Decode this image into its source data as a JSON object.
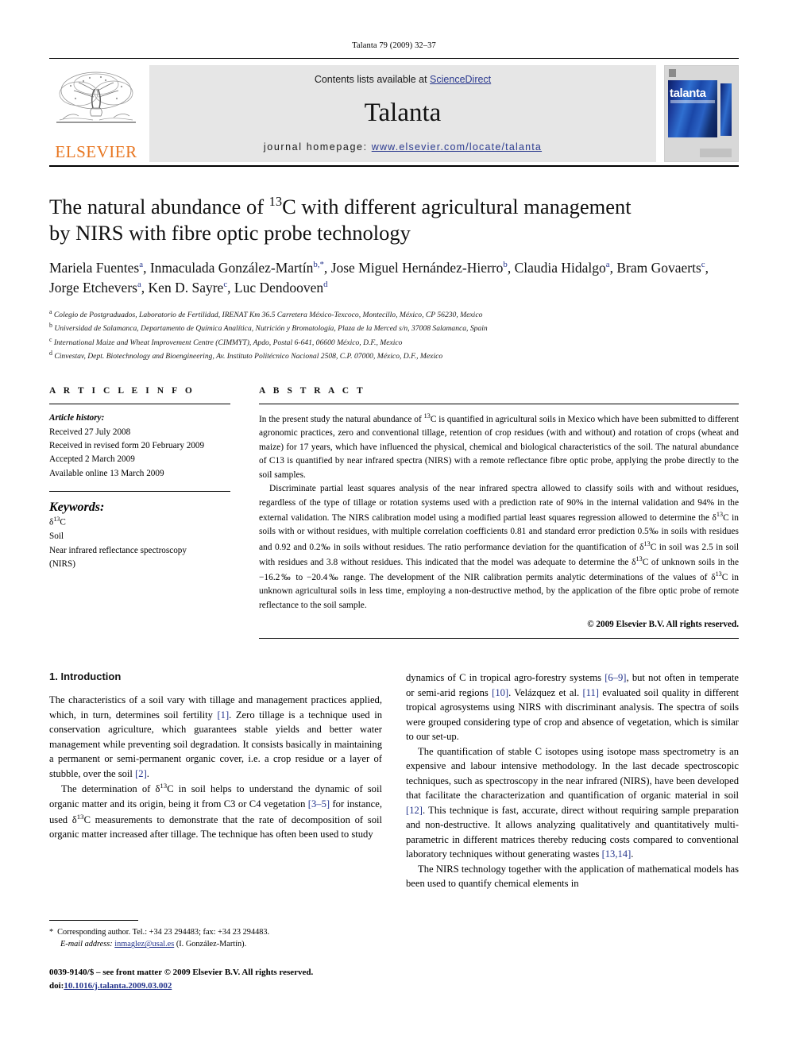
{
  "running_head": "Talanta 79 (2009) 32–37",
  "masthead": {
    "publisher": "ELSEVIER",
    "contents_prefix": "Contents lists available at ",
    "contents_link": "ScienceDirect",
    "journal": "Talanta",
    "homepage_label": "journal homepage:",
    "homepage_url": "www.elsevier.com/locate/talanta",
    "cover_title": "talanta",
    "link_color": "#2b3a8f"
  },
  "article": {
    "title_line1_pre": "The natural abundance of ",
    "title_sup": "13",
    "title_line1_post": "C with different agricultural management",
    "title_line2": "by NIRS with fibre optic probe technology",
    "authors": [
      {
        "name": "Mariela Fuentes",
        "marks": "a",
        "sep": ", "
      },
      {
        "name": "Inmaculada González-Martín",
        "marks": "b,*",
        "sep": ", "
      },
      {
        "name": "Jose Miguel Hernández-Hierro",
        "marks": "b",
        "sep": ","
      },
      {
        "name": "Claudia Hidalgo",
        "marks": "a",
        "sep": ", "
      },
      {
        "name": "Bram Govaerts",
        "marks": "c",
        "sep": ", "
      },
      {
        "name": "Jorge Etchevers",
        "marks": "a",
        "sep": ", "
      },
      {
        "name": "Ken D. Sayre",
        "marks": "c",
        "sep": ", "
      },
      {
        "name": "Luc Dendooven",
        "marks": "d",
        "sep": ""
      }
    ],
    "affiliations": [
      {
        "mark": "a",
        "text": "Colegio de Postgraduados, Laboratorio de Fertilidad, IRENAT Km 36.5 Carretera México-Texcoco, Montecillo, México, CP 56230, Mexico"
      },
      {
        "mark": "b",
        "text": "Universidad de Salamanca, Departamento de Química Analítica, Nutrición y Bromatología, Plaza de la Merced s/n, 37008 Salamanca, Spain"
      },
      {
        "mark": "c",
        "text": "International Maize and Wheat Improvement Centre (CIMMYT), Apdo, Postal 6-641, 06600 México, D.F., Mexico"
      },
      {
        "mark": "d",
        "text": "Cinvestav, Dept. Biotechnology and Bioengineering, Av. Instituto Politécnico Nacional 2508, C.P. 07000, México, D.F., Mexico"
      }
    ]
  },
  "info": {
    "heading": "A R T I C L E    I N F O",
    "history_label": "Article history:",
    "history": [
      "Received 27 July 2008",
      "Received in revised form 20 February 2009",
      "Accepted 2 March 2009",
      "Available online 13 March 2009"
    ],
    "keywords_label": "Keywords:",
    "keywords_delta": "δ",
    "keywords_delta_sup": "13",
    "keywords_delta_post": "C",
    "keywords_rest": [
      "Soil",
      "Near infrared reflectance spectroscopy",
      "(NIRS)"
    ]
  },
  "abstract": {
    "heading": "A B S T R A C T",
    "p1": "In the present study the natural abundance of 13C is quantified in agricultural soils in Mexico which have been submitted to different agronomic practices, zero and conventional tillage, retention of crop residues (with and without) and rotation of crops (wheat and maize) for 17 years, which have influenced the physical, chemical and biological characteristics of the soil. The natural abundance of C13 is quantified by near infrared spectra (NIRS) with a remote reflectance fibre optic probe, applying the probe directly to the soil samples.",
    "p2": "Discriminate partial least squares analysis of the near infrared spectra allowed to classify soils with and without residues, regardless of the type of tillage or rotation systems used with a prediction rate of 90% in the internal validation and 94% in the external validation. The NIRS calibration model using a modified partial least squares regression allowed to determine the δ13C in soils with or without residues, with multiple correlation coefficients 0.81 and standard error prediction 0.5‰ in soils with residues and 0.92 and 0.2‰ in soils without residues. The ratio performance deviation for the quantification of δ13C in soil was 2.5 in soil with residues and 3.8 without residues. This indicated that the model was adequate to determine the δ13C of unknown soils in the −16.2‰ to −20.4‰ range. The development of the NIR calibration permits analytic determinations of the values of δ13C in unknown agricultural soils in less time, employing a non-destructive method, by the application of the fibre optic probe of remote reflectance to the soil sample.",
    "copyright": "© 2009 Elsevier B.V. All rights reserved."
  },
  "body": {
    "section_number_title": "1.  Introduction",
    "left_p1": "The characteristics of a soil vary with tillage and management practices applied, which, in turn, determines soil fertility [1]. Zero tillage is a technique used in conservation agriculture, which guarantees stable yields and better water management while preventing soil degradation. It consists basically in maintaining a permanent or semi-permanent organic cover, i.e. a crop residue or a layer of stubble, over the soil [2].",
    "left_p2": "The determination of δ13C in soil helps to understand the dynamic of soil organic matter and its origin, being it from C3 or C4 vegetation [3–5] for instance, used δ13C measurements to demonstrate that the rate of decomposition of soil organic matter increased after tillage. The technique has often been used to study",
    "right_p1": "dynamics of C in tropical agro-forestry systems [6–9], but not often in temperate or semi-arid regions [10]. Velázquez et al. [11] evaluated soil quality in different tropical agrosystems using NIRS with discriminant analysis. The spectra of soils were grouped considering type of crop and absence of vegetation, which is similar to our set-up.",
    "right_p2": "The quantification of stable C isotopes using isotope mass spectrometry is an expensive and labour intensive methodology. In the last decade spectroscopic techniques, such as spectroscopy in the near infrared (NIRS), have been developed that facilitate the characterization and quantification of organic material in soil [12]. This technique is fast, accurate, direct without requiring sample preparation and non-destructive. It allows analyzing qualitatively and quantitatively multi-parametric in different matrices thereby reducing costs compared to conventional laboratory techniques without generating wastes [13,14].",
    "right_p3": "The NIRS technology together with the application of mathematical models has been used to quantify chemical elements in"
  },
  "footnote": {
    "corresponding": "Corresponding author. Tel.: +34 23 294483; fax: +34 23 294483.",
    "email_label": "E-mail address:",
    "email": "inmaglez@usal.es",
    "email_owner": "(I. González-Martín)."
  },
  "imprint": {
    "line1": "0039-9140/$ – see front matter © 2009 Elsevier B.V. All rights reserved.",
    "doi_label": "doi:",
    "doi": "10.1016/j.talanta.2009.03.002"
  }
}
